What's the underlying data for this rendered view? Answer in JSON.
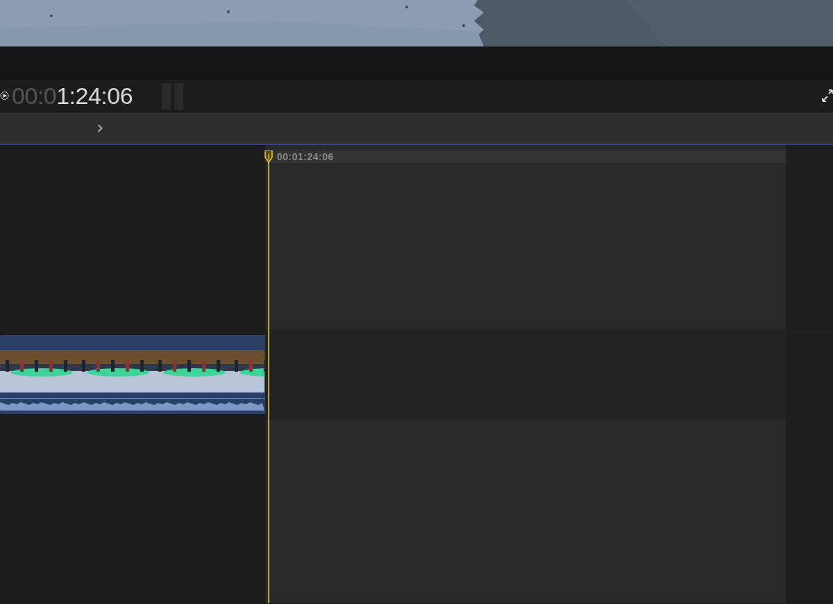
{
  "toolbar": {
    "timecode": {
      "dim_part": "00:0",
      "bright_part": "1:24:06"
    }
  },
  "timeline": {
    "playhead_timecode": "00:01:24:06"
  }
}
